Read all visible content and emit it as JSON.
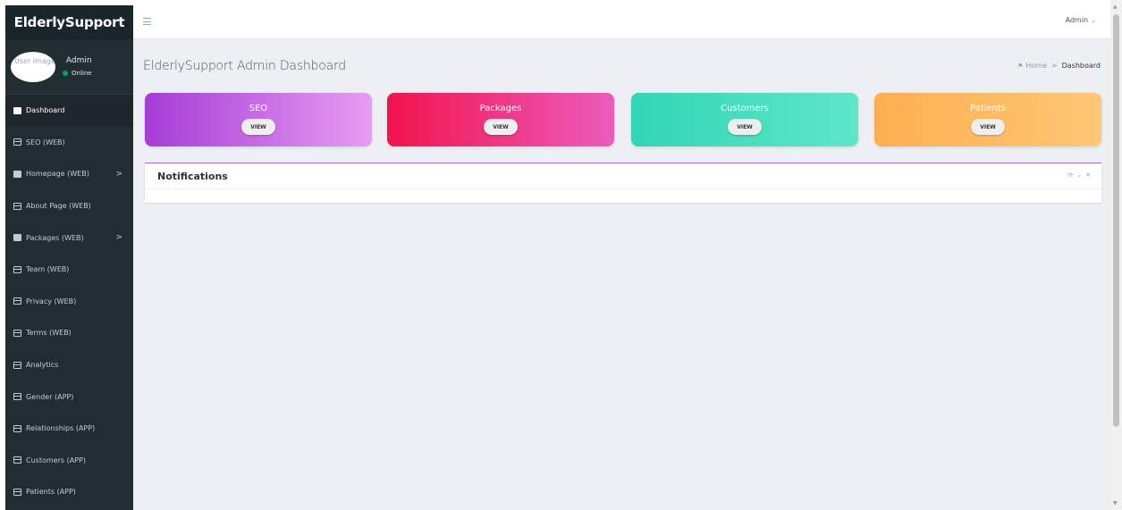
{
  "sidebar": {
    "brand": "ElderlySupport",
    "user": {
      "avatar_alt": "User Image",
      "name": "Admin",
      "status": "Online"
    },
    "items": [
      {
        "label": "Dashboard",
        "icon": "dashboard-icon",
        "active": true
      },
      {
        "label": "SEO (WEB)",
        "icon": "table-icon"
      },
      {
        "label": "Homepage (WEB)",
        "icon": "book-icon",
        "has_children": true
      },
      {
        "label": "About Page (WEB)",
        "icon": "table-icon"
      },
      {
        "label": "Packages (WEB)",
        "icon": "book-icon",
        "has_children": true
      },
      {
        "label": "Team (WEB)",
        "icon": "table-icon"
      },
      {
        "label": "Privacy (WEB)",
        "icon": "table-icon"
      },
      {
        "label": "Terms (WEB)",
        "icon": "table-icon"
      },
      {
        "label": "Analytics",
        "icon": "table-icon"
      },
      {
        "label": "Gender (APP)",
        "icon": "table-icon"
      },
      {
        "label": "Relationships (APP)",
        "icon": "table-icon"
      },
      {
        "label": "Customers (APP)",
        "icon": "table-icon"
      },
      {
        "label": "Patients (APP)",
        "icon": "table-icon"
      }
    ],
    "chevron": ">"
  },
  "header": {
    "user_menu": "Admin",
    "caret": "⌄"
  },
  "main": {
    "title": "ElderlySupport Admin Dashboard",
    "breadcrumb": {
      "home": "Home",
      "separator": ">",
      "current": "Dashboard"
    },
    "cards": [
      {
        "title": "SEO",
        "button": "VIEW",
        "colors": [
          "#a53cd6",
          "#e89cf2"
        ]
      },
      {
        "title": "Packages",
        "button": "VIEW",
        "colors": [
          "#f3134d",
          "#ec5cbe"
        ]
      },
      {
        "title": "Customers",
        "button": "VIEW",
        "colors": [
          "#31d6b4",
          "#5ee6c9"
        ]
      },
      {
        "title": "Patients",
        "button": "VIEW",
        "colors": [
          "#ffae4f",
          "#ffc775"
        ]
      }
    ],
    "panel": {
      "title": "Notifications",
      "accent": "#a76be0"
    }
  }
}
